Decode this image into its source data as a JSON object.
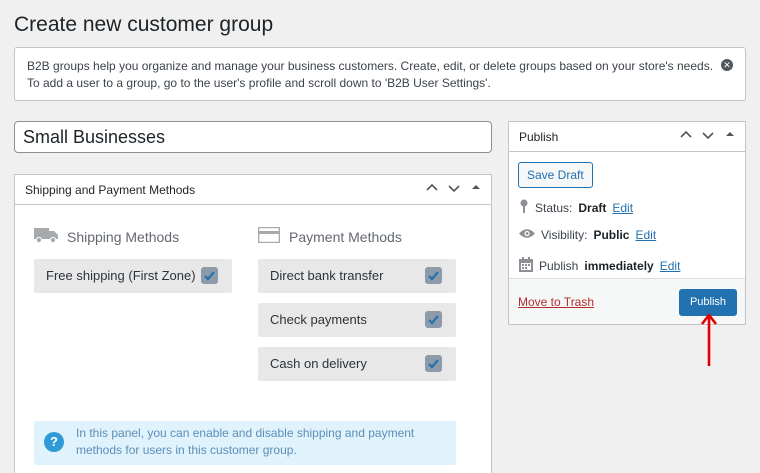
{
  "page": {
    "title": "Create new customer group",
    "notice": "B2B groups help you organize and manage your business customers. Create, edit, or delete groups based on your store's needs. To add a user to a group, go to the user's profile and scroll down to 'B2B User Settings'."
  },
  "group_title": {
    "value": "Small Businesses"
  },
  "methods_box": {
    "title": "Shipping and Payment Methods",
    "shipping": {
      "title": "Shipping Methods",
      "icon": "truck-icon",
      "items": [
        {
          "label": "Free shipping (First Zone)",
          "checked": true
        }
      ]
    },
    "payment": {
      "title": "Payment Methods",
      "icon": "credit-card-icon",
      "items": [
        {
          "label": "Direct bank transfer",
          "checked": true
        },
        {
          "label": "Check payments",
          "checked": true
        },
        {
          "label": "Cash on delivery",
          "checked": true
        }
      ]
    },
    "info": "In this panel, you can enable and disable shipping and payment methods for users in this customer group."
  },
  "publish_box": {
    "title": "Publish",
    "save_draft": "Save Draft",
    "status": {
      "label": "Status:",
      "value": "Draft",
      "edit": "Edit"
    },
    "visibility": {
      "label": "Visibility:",
      "value": "Public",
      "edit": "Edit"
    },
    "schedule": {
      "label": "Publish",
      "value": "immediately",
      "edit": "Edit"
    },
    "trash": "Move to Trash",
    "publish_button": "Publish"
  },
  "colors": {
    "accent": "#2271b1",
    "trash": "#b32d2e",
    "annotation_arrow": "#e00000",
    "info_bg": "#e0f2fb"
  }
}
